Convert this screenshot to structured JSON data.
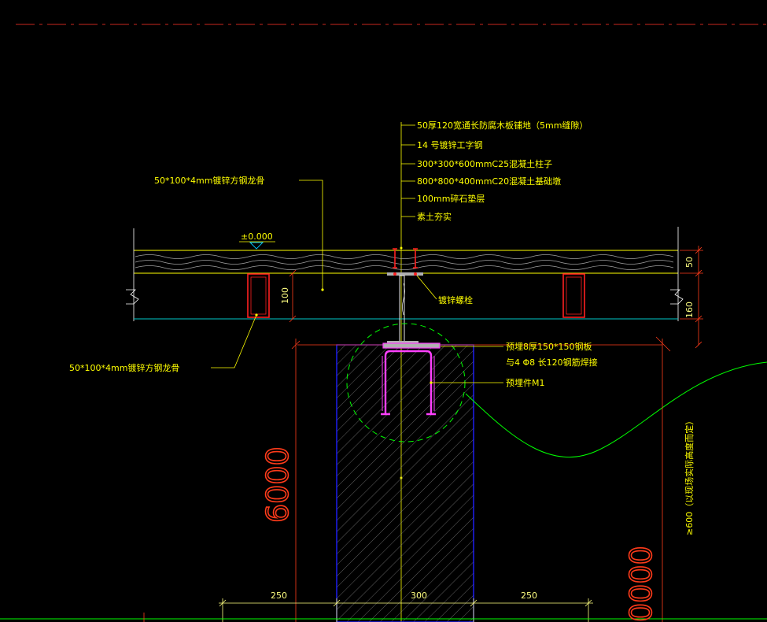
{
  "callouts": {
    "item1": "50厚120宽通长防腐木板铺地（5mm缝隙）",
    "item2": "14 号镀锌工字钢",
    "item3": "300*300*600mmC25混凝土柱子",
    "item4": "800*800*400mmC20混凝土基础墩",
    "item5": "100mm碎石垫层",
    "item6": "素土夯实",
    "keel_top": "50*100*4mm镀锌方钢龙骨",
    "keel_bottom": "50*100*4mm镀锌方钢龙骨",
    "bolt": "镀锌螺栓",
    "plate_line1": "预埋8厚150*150钢板",
    "plate_line2": "与4 Φ8 长120钢筋焊接",
    "embed": "预埋件M1"
  },
  "elevation": "±0.000",
  "dimensions": {
    "deck": "50",
    "joist_gap": "160",
    "keel_height": "100",
    "left_width": "250",
    "center_width": "300",
    "right_width": "250",
    "depth_big": "6000",
    "right_big": "0000",
    "vertical_note": "≥600（以现场实际高度而定）"
  },
  "colors": {
    "background": "#000000",
    "annotation": "#ffff00",
    "dimension": "#ff3b1a",
    "steel": "#ff2020",
    "plate": "#ff40ff",
    "pier": "#2020ff",
    "hatch": "#b0b0b0",
    "boundary": "#00ff00",
    "ground": "#00c8c8"
  }
}
